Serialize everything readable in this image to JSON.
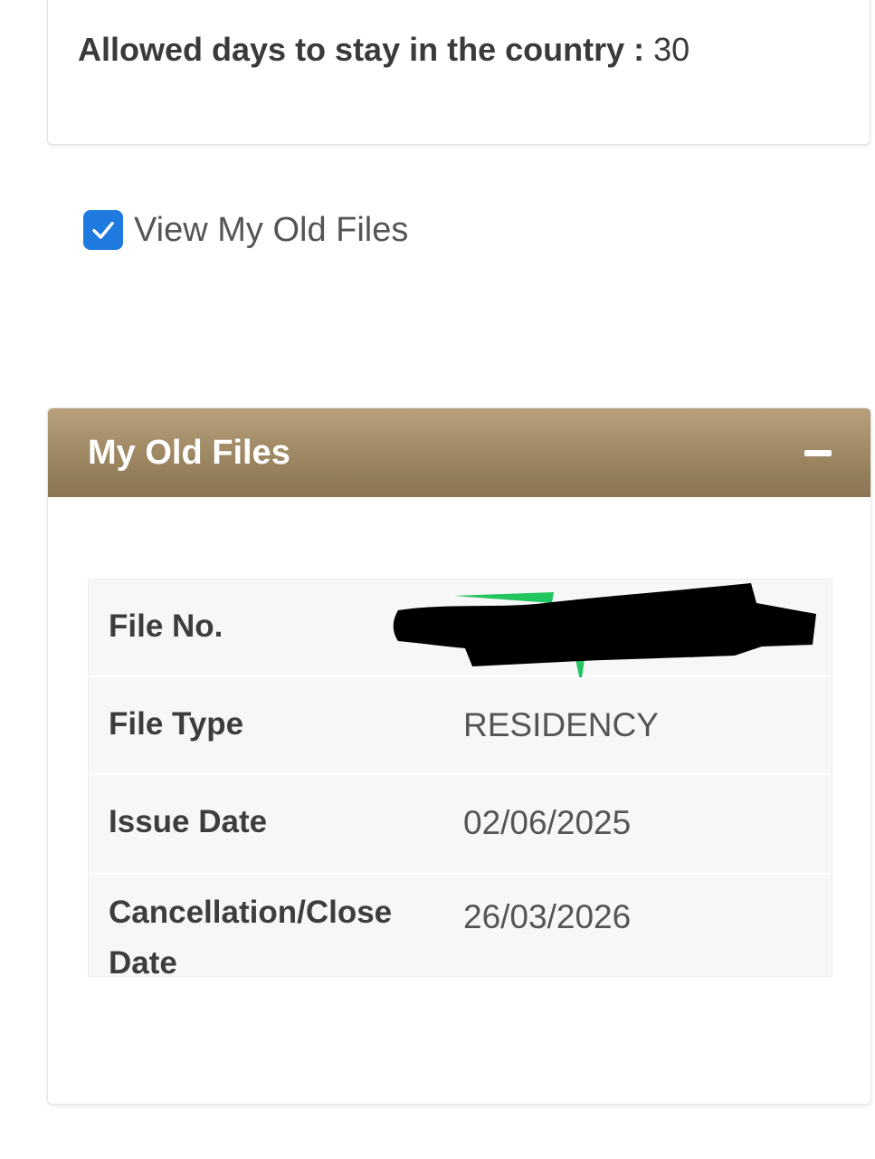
{
  "stay_info": {
    "allowed_days_label": "Allowed days to stay in the country",
    "separator": " : ",
    "allowed_days_value": "30"
  },
  "old_files_toggle": {
    "label": "View My Old Files",
    "checked": true
  },
  "old_files_panel": {
    "title": "My Old Files",
    "rows": [
      {
        "label": "File No.",
        "value": ""
      },
      {
        "label": "File Type",
        "value": "RESIDENCY"
      },
      {
        "label": "Issue Date",
        "value": "02/06/2025"
      },
      {
        "label": "Cancellation/Close Date",
        "value": "26/03/2026"
      }
    ]
  },
  "colors": {
    "header_gradient_top": "#b8a07c",
    "header_gradient_bottom": "#8b7552",
    "checkbox_blue": "#1f7ae0"
  },
  "icons": {
    "checkbox": "checkmark-icon",
    "collapse": "minus-icon"
  }
}
